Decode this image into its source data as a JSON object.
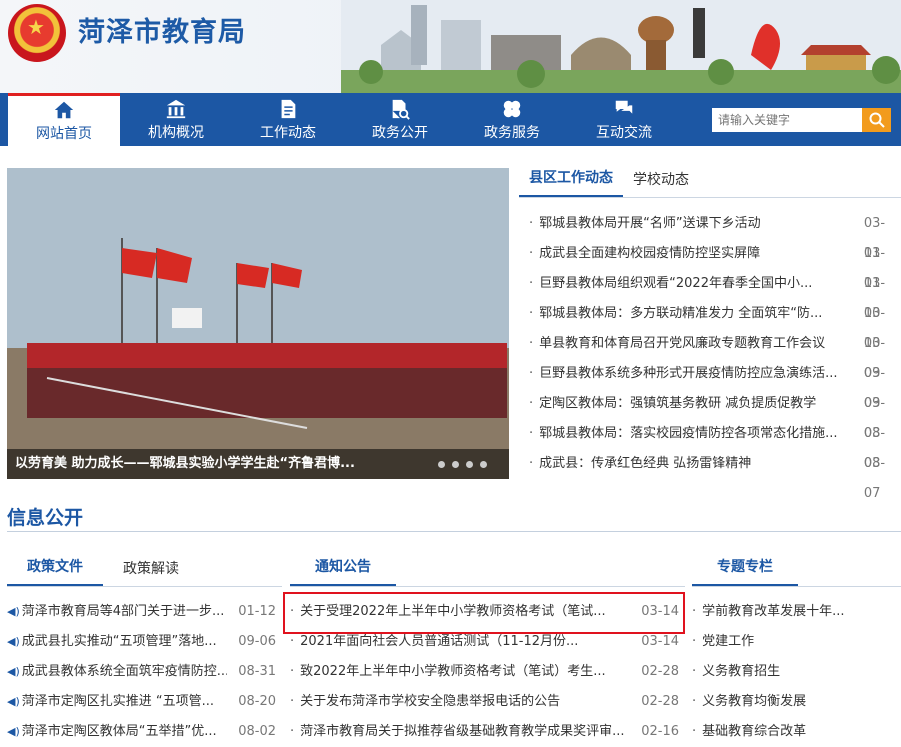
{
  "header": {
    "site_title": "菏泽市教育局"
  },
  "nav": {
    "items": [
      {
        "label": "网站首页",
        "icon": "home-icon"
      },
      {
        "label": "机构概况",
        "icon": "building-icon"
      },
      {
        "label": "工作动态",
        "icon": "document-icon"
      },
      {
        "label": "政务公开",
        "icon": "file-search-icon"
      },
      {
        "label": "政务服务",
        "icon": "clover-icon"
      },
      {
        "label": "互动交流",
        "icon": "chat-icon"
      }
    ],
    "search_placeholder": "请输入关键字"
  },
  "slider": {
    "caption": "以劳育美 助力成长——郓城县实验小学学生赴“齐鲁君博..."
  },
  "news": {
    "tabs": [
      "县区工作动态",
      "学校动态"
    ],
    "items": [
      {
        "title": "郓城县教体局开展“名师”送课下乡活动",
        "date": "03-11"
      },
      {
        "title": "成武县全面建构校园疫情防控坚实屏障",
        "date": "03-11"
      },
      {
        "title": "巨野县教体局组织观看“2022年春季全国中小...",
        "date": "03-10"
      },
      {
        "title": "郓城县教体局：多方联动精准发力 全面筑牢“防...",
        "date": "03-10"
      },
      {
        "title": "单县教育和体育局召开党风廉政专题教育工作会议",
        "date": "03-09"
      },
      {
        "title": "巨野县教体系统多种形式开展疫情防控应急演练活...",
        "date": "03-09"
      },
      {
        "title": "定陶区教体局：强镇筑基务教研 减负提质促教学",
        "date": "03-08"
      },
      {
        "title": "郓城县教体局：落实校园疫情防控各项常态化措施...",
        "date": "03-08"
      },
      {
        "title": "成武县：传承红色经典 弘扬雷锋精神",
        "date": "03-07"
      }
    ]
  },
  "info": {
    "section_title": "信息公开",
    "policy": {
      "tabs": [
        "政策文件",
        "政策解读"
      ],
      "items": [
        {
          "title": "菏泽市教育局等4部门关于进一步...",
          "date": "01-12"
        },
        {
          "title": "成武县扎实推动“五项管理”落地...",
          "date": "09-06"
        },
        {
          "title": "成武县教体系统全面筑牢疫情防控...",
          "date": "08-31"
        },
        {
          "title": "菏泽市定陶区扎实推进 “五项管...",
          "date": "08-20"
        },
        {
          "title": "菏泽市定陶区教体局“五举措”优...",
          "date": "08-02"
        }
      ]
    },
    "notice": {
      "tab": "通知公告",
      "items": [
        {
          "title": "关于受理2022年上半年中小学教师资格考试（笔试...",
          "date": "03-14"
        },
        {
          "title": "2021年面向社会人员普通话测试（11-12月份...",
          "date": "03-14"
        },
        {
          "title": "致2022年上半年中小学教师资格考试（笔试）考生...",
          "date": "02-28"
        },
        {
          "title": "关于发布菏泽市学校安全隐患举报电话的公告",
          "date": "02-28"
        },
        {
          "title": "菏泽市教育局关于拟推荐省级基础教育教学成果奖评审...",
          "date": "02-16"
        }
      ]
    },
    "topics": {
      "tab": "专题专栏",
      "items": [
        "学前教育改革发展十年...",
        "党建工作",
        "义务教育招生",
        "义务教育均衡发展",
        "基础教育综合改革"
      ]
    }
  }
}
